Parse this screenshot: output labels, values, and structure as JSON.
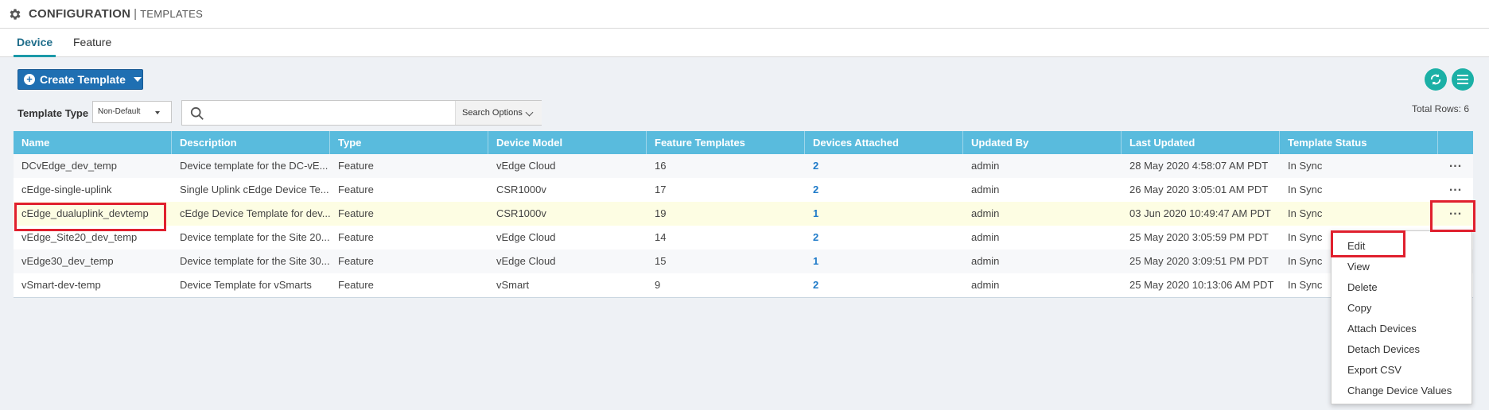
{
  "header": {
    "title": "CONFIGURATION",
    "separator": "|",
    "subtitle": "TEMPLATES"
  },
  "tabs": [
    {
      "label": "Device",
      "active": true
    },
    {
      "label": "Feature",
      "active": false
    }
  ],
  "toolbar": {
    "create_label": "Create Template"
  },
  "filter": {
    "template_type_label": "Template Type",
    "template_type_value": "Non-Default",
    "search_placeholder": "",
    "search_options_label": "Search Options"
  },
  "total_rows": "Total Rows: 6",
  "table": {
    "columns": [
      "Name",
      "Description",
      "Type",
      "Device Model",
      "Feature Templates",
      "Devices Attached",
      "Updated By",
      "Last Updated",
      "Template Status"
    ],
    "rows": [
      [
        "DCvEdge_dev_temp",
        "Device template for the DC-vE...",
        "Feature",
        "vEdge Cloud",
        "16",
        "2",
        "admin",
        "28 May 2020 4:58:07 AM PDT",
        "In Sync"
      ],
      [
        "cEdge-single-uplink",
        "Single Uplink cEdge Device Te...",
        "Feature",
        "CSR1000v",
        "17",
        "2",
        "admin",
        "26 May 2020 3:05:01 AM PDT",
        "In Sync"
      ],
      [
        "cEdge_dualuplink_devtemp",
        "cEdge Device Template for dev...",
        "Feature",
        "CSR1000v",
        "19",
        "1",
        "admin",
        "03 Jun 2020 10:49:47 AM PDT",
        "In Sync"
      ],
      [
        "vEdge_Site20_dev_temp",
        "Device template for the Site 20...",
        "Feature",
        "vEdge Cloud",
        "14",
        "2",
        "admin",
        "25 May 2020 3:05:59 PM PDT",
        "In Sync"
      ],
      [
        "vEdge30_dev_temp",
        "Device template for the Site 30...",
        "Feature",
        "vEdge Cloud",
        "15",
        "1",
        "admin",
        "25 May 2020 3:09:51 PM PDT",
        "In Sync"
      ],
      [
        "vSmart-dev-temp",
        "Device Template for vSmarts",
        "Feature",
        "vSmart",
        "9",
        "2",
        "admin",
        "25 May 2020 10:13:06 AM PDT",
        "In Sync"
      ]
    ],
    "row_action_label": "..."
  },
  "context_menu": {
    "items": [
      "Edit",
      "View",
      "Delete",
      "Copy",
      "Attach Devices",
      "Detach Devices",
      "Export CSV",
      "Change Device Values"
    ]
  },
  "colors": {
    "header_bg": "#59bbdd",
    "accent": "#1f6fb2",
    "teal": "#1bb0a6",
    "highlight": "#e0202e",
    "link": "#1f7bc9"
  }
}
